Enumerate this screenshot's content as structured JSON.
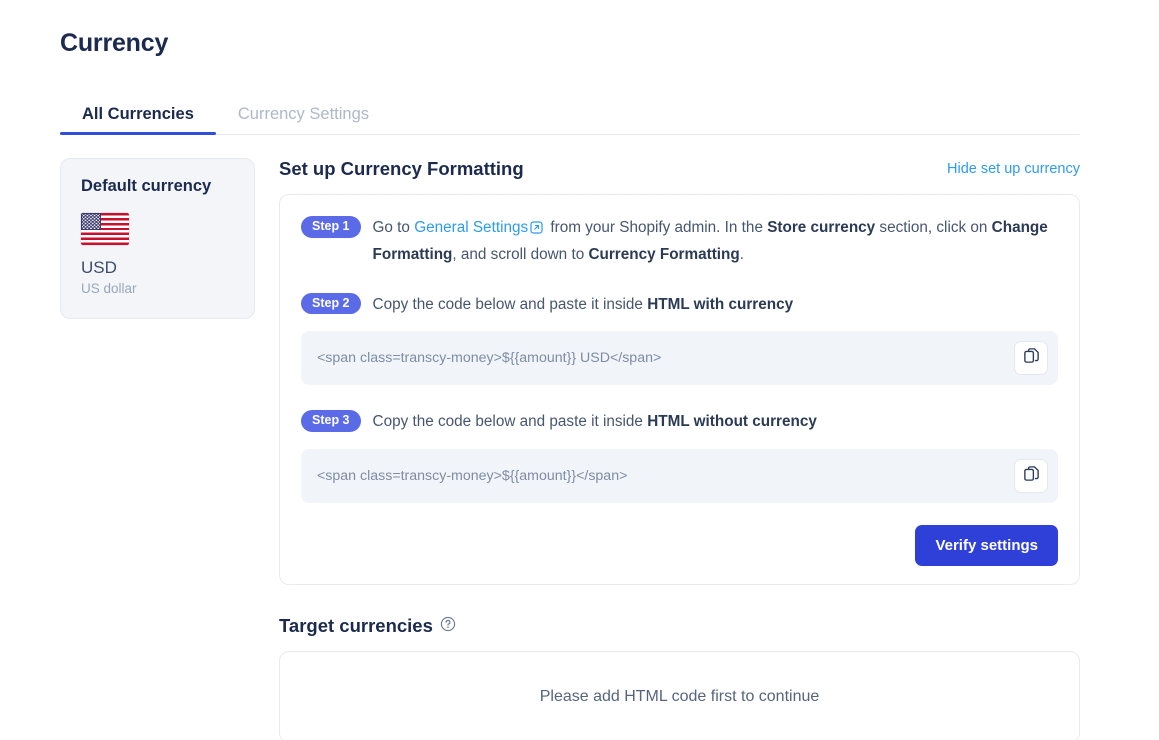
{
  "page": {
    "title": "Currency"
  },
  "tabs": [
    {
      "label": "All Currencies",
      "active": true
    },
    {
      "label": "Currency Settings",
      "active": false
    }
  ],
  "sidebar": {
    "heading": "Default currency",
    "flag_icon": "us-flag-icon",
    "code": "USD",
    "name": "US dollar"
  },
  "setup": {
    "heading": "Set up Currency Formatting",
    "hide_link": "Hide set up currency",
    "steps": [
      {
        "badge": "Step 1",
        "text_prefix": "Go to ",
        "link": "General Settings",
        "link_icon": "external-link-icon",
        "text_mid1": " from your Shopify admin. In the ",
        "bold1": "Store currency",
        "text_mid2": " section, click on ",
        "bold2": "Change Formatting",
        "text_mid3": ", and scroll down to ",
        "bold3": "Currency Formatting",
        "text_suffix": "."
      },
      {
        "badge": "Step 2",
        "text_prefix": "Copy the code below and paste it inside ",
        "bold1": "HTML with currency",
        "code": "<span class=transcy-money>${{amount}} USD</span>",
        "copy_icon": "copy-icon"
      },
      {
        "badge": "Step 3",
        "text_prefix": "Copy the code below and paste it inside ",
        "bold1": "HTML without currency",
        "code": "<span class=transcy-money>${{amount}}</span>",
        "copy_icon": "copy-icon"
      }
    ],
    "verify_label": "Verify settings"
  },
  "target": {
    "heading": "Target currencies",
    "help_icon": "help-circle-icon",
    "empty_message": "Please add HTML code first to continue"
  },
  "colors": {
    "accent_blue": "#2f40d8",
    "badge_indigo": "#5b6be8",
    "link_blue": "#2e9bf0",
    "title_navy": "#1b2a4e"
  }
}
